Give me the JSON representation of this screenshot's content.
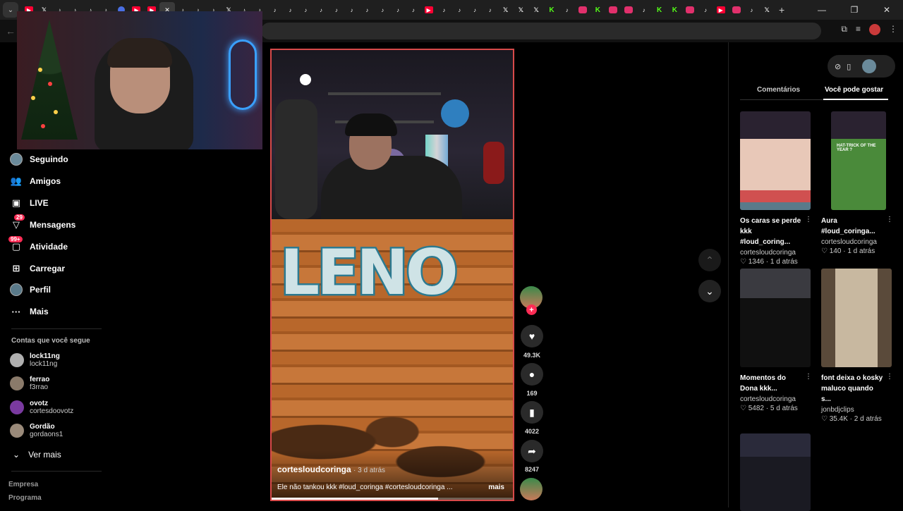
{
  "browser": {
    "tabs": [
      "yt",
      "x",
      "tt",
      "tt",
      "tt",
      "tt",
      "ch",
      "yt",
      "yt",
      "x-close",
      "tt",
      "tt",
      "tt",
      "x",
      "tt",
      "tt",
      "tt",
      "tt",
      "tt",
      "tt",
      "tt",
      "tt",
      "tt",
      "tt",
      "tt",
      "tt",
      "yt",
      "tt",
      "tt",
      "tt",
      "tt",
      "x",
      "x",
      "x",
      "kick",
      "tt",
      "ig",
      "kick",
      "ig",
      "ig",
      "tt",
      "kick",
      "kick",
      "ig",
      "tt",
      "yt",
      "ig",
      "tt",
      "x"
    ],
    "new_tab": "+",
    "window_controls": [
      "—",
      "❐",
      "✕"
    ]
  },
  "sidebar": {
    "nav": [
      {
        "label": "Seguindo",
        "icon": "following-avatar-icon"
      },
      {
        "label": "Amigos",
        "icon": "friends-icon"
      },
      {
        "label": "LIVE",
        "icon": "live-icon"
      },
      {
        "label": "Mensagens",
        "icon": "messages-icon",
        "badge": "29"
      },
      {
        "label": "Atividade",
        "icon": "activity-icon",
        "badge": "99+"
      },
      {
        "label": "Carregar",
        "icon": "upload-icon"
      },
      {
        "label": "Perfil",
        "icon": "profile-avatar-icon"
      },
      {
        "label": "Mais",
        "icon": "more-icon"
      }
    ],
    "following_title": "Contas que você segue",
    "accounts": [
      {
        "name": "lock11ng",
        "handle": "lock11ng",
        "color": "#b0b0b0"
      },
      {
        "name": "ferrao",
        "handle": "f3rrao",
        "color": "#8a7a6a"
      },
      {
        "name": "ovotz",
        "handle": "cortesdoovotz",
        "color": "#7a3aa0"
      },
      {
        "name": "Gordão",
        "handle": "gordaons1",
        "color": "#9a8a7a"
      }
    ],
    "see_more": "Ver mais",
    "footer": [
      "Empresa",
      "Programa"
    ]
  },
  "video": {
    "sign_text": "LENO",
    "author": "cortesloudcoringa",
    "time": "· 3 d atrás",
    "description": "Ele não tankou kkk #loud_coringa #cortesloudcoringa ...",
    "more": "mais",
    "progress": 0.69
  },
  "actions": {
    "plus": "+",
    "likes": "49.3K",
    "comments": "169",
    "saves": "4022",
    "shares": "8247"
  },
  "right_panel": {
    "tabs": [
      "Comentários",
      "Você pode gostar"
    ],
    "cards": [
      {
        "title": "Os caras se perde kkk #loud_coring...",
        "author": "cortesloudcoringa",
        "likes": "1346",
        "time": "1 d atrás"
      },
      {
        "title": "Aura #loud_coringa...",
        "author": "cortesloudcoringa",
        "likes": "140",
        "time": "1 d atrás"
      },
      {
        "title": "Momentos do Dona kkk...",
        "author": "cortesloudcoringa",
        "likes": "5482",
        "time": "5 d atrás"
      },
      {
        "title": "font deixa o kosky maluco quando s...",
        "author": "jonbdjclips",
        "likes": "35.4K",
        "time": "2 d atrás"
      }
    ],
    "thumb_caption": "HAT-TRICK OF THE YEAR ?"
  },
  "colors": {
    "accent": "#fe2c55",
    "video_border": "#d84a4a",
    "kick": "#53fc18"
  }
}
